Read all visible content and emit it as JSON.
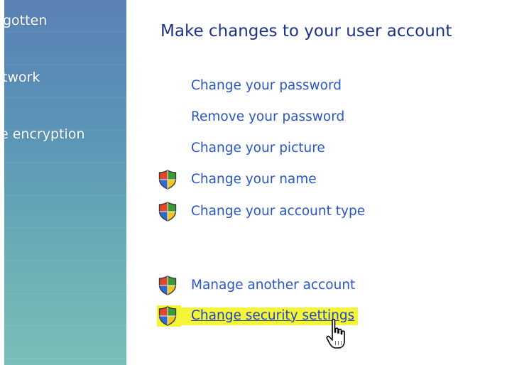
{
  "sidebar": {
    "items": [
      {
        "label": "gotten"
      },
      {
        "label": "twork"
      },
      {
        "label": "e encryption"
      }
    ]
  },
  "main": {
    "title": "Make changes to your user account",
    "tasks": [
      {
        "label": "Change your password",
        "shield": false
      },
      {
        "label": "Remove your password",
        "shield": false
      },
      {
        "label": "Change your picture",
        "shield": false
      },
      {
        "label": "Change your name",
        "shield": true
      },
      {
        "label": "Change your account type",
        "shield": true
      }
    ],
    "other_tasks": [
      {
        "label": "Manage another account",
        "shield": true
      },
      {
        "label": "Change security settings",
        "shield": true,
        "highlighted": true
      }
    ]
  },
  "colors": {
    "link": "#2a55c6",
    "title": "#1e3287",
    "highlight": "#f5f538",
    "sidebar_top": "#5a82b4",
    "sidebar_bottom": "#78bfb8"
  },
  "icons": {
    "shield": "uac-shield-icon",
    "cursor": "hand-pointer-cursor-icon"
  }
}
